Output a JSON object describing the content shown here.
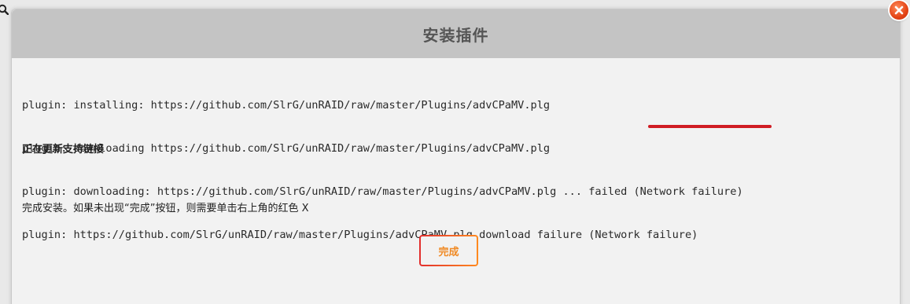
{
  "dialog": {
    "title": "安装插件",
    "log_lines": [
      "plugin: installing: https://github.com/SlrG/unRAID/raw/master/Plugins/advCPaMV.plg",
      "plugin: downloading https://github.com/SlrG/unRAID/raw/master/Plugins/advCPaMV.plg",
      "plugin: downloading: https://github.com/SlrG/unRAID/raw/master/Plugins/advCPaMV.plg ... failed (Network failure)",
      "plugin: https://github.com/SlrG/unRAID/raw/master/Plugins/advCPaMV.plg download failure (Network failure)"
    ],
    "status_bold": "正在更新支持链接",
    "status_note": "完成安装。如果未出现“完成”按钮，则需要单击右上角的红色 X",
    "done_label": "完成"
  },
  "icons": {
    "search": "search-icon",
    "close": "close-icon"
  },
  "colors": {
    "header_bg": "#c4c4c4",
    "dialog_bg": "#f2f2f2",
    "accent_orange": "#f08a24",
    "highlight_red": "#d01d24",
    "close_red": "#e44415"
  }
}
